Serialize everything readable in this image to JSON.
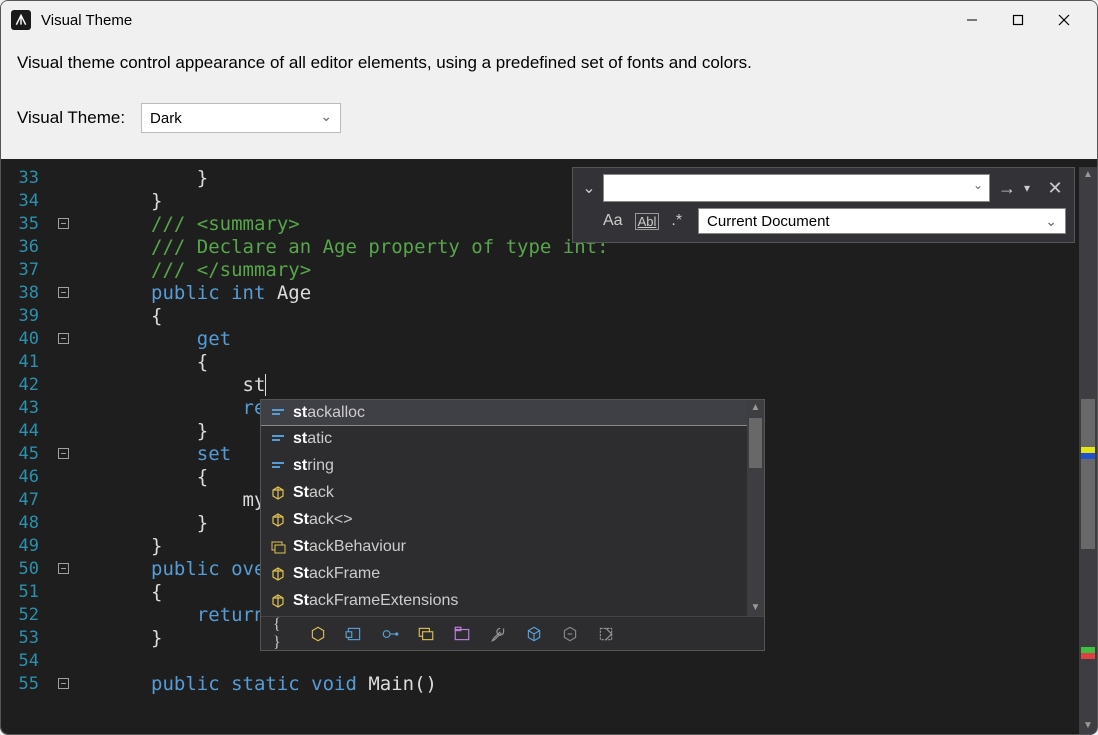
{
  "window": {
    "title": "Visual Theme"
  },
  "header": {
    "description": "Visual theme control appearance of all editor elements, using a predefined set of fonts and colors.",
    "label": "Visual Theme:",
    "selected": "Dark"
  },
  "find_panel": {
    "scope": "Current Document",
    "options": {
      "match_case": "Aa",
      "whole_word": "Abl",
      "regex": ".*"
    }
  },
  "code": {
    "lines": [
      {
        "n": 33,
        "fold": "",
        "mod": false,
        "ind": 3,
        "tokens": [
          {
            "t": "}",
            "c": "p"
          }
        ]
      },
      {
        "n": 34,
        "fold": "",
        "mod": false,
        "ind": 2,
        "tokens": [
          {
            "t": "}",
            "c": "p"
          }
        ]
      },
      {
        "n": 35,
        "fold": "box",
        "mod": false,
        "ind": 2,
        "tokens": [
          {
            "t": "/// <summary>",
            "c": "com"
          }
        ]
      },
      {
        "n": 36,
        "fold": "",
        "mod": false,
        "ind": 2,
        "tokens": [
          {
            "t": "/// Declare an Age property of type int:",
            "c": "com"
          }
        ]
      },
      {
        "n": 37,
        "fold": "",
        "mod": false,
        "ind": 2,
        "tokens": [
          {
            "t": "/// </summary>",
            "c": "com"
          }
        ]
      },
      {
        "n": 38,
        "fold": "box",
        "mod": false,
        "ind": 2,
        "tokens": [
          {
            "t": "public ",
            "c": "kw"
          },
          {
            "t": "int ",
            "c": "kw"
          },
          {
            "t": "Age",
            "c": "p"
          }
        ]
      },
      {
        "n": 39,
        "fold": "",
        "mod": false,
        "ind": 2,
        "tokens": [
          {
            "t": "{",
            "c": "p"
          }
        ]
      },
      {
        "n": 40,
        "fold": "box",
        "mod": false,
        "ind": 3,
        "tokens": [
          {
            "t": "get",
            "c": "kw"
          }
        ]
      },
      {
        "n": 41,
        "fold": "",
        "mod": true,
        "ind": 3,
        "tokens": [
          {
            "t": "{",
            "c": "p"
          }
        ]
      },
      {
        "n": 42,
        "fold": "",
        "mod": true,
        "ind": 4,
        "tokens": [
          {
            "t": "st",
            "c": "p"
          }
        ],
        "caret": true
      },
      {
        "n": 43,
        "fold": "",
        "mod": false,
        "ind": 4,
        "tokens": [
          {
            "t": "ret",
            "c": "kw"
          }
        ]
      },
      {
        "n": 44,
        "fold": "",
        "mod": false,
        "ind": 3,
        "tokens": [
          {
            "t": "}",
            "c": "p"
          }
        ]
      },
      {
        "n": 45,
        "fold": "box",
        "mod": false,
        "ind": 3,
        "tokens": [
          {
            "t": "set",
            "c": "kw"
          }
        ]
      },
      {
        "n": 46,
        "fold": "",
        "mod": false,
        "ind": 3,
        "tokens": [
          {
            "t": "{",
            "c": "p"
          }
        ]
      },
      {
        "n": 47,
        "fold": "",
        "mod": false,
        "ind": 4,
        "tokens": [
          {
            "t": "myA",
            "c": "p"
          }
        ]
      },
      {
        "n": 48,
        "fold": "",
        "mod": false,
        "ind": 3,
        "tokens": [
          {
            "t": "}",
            "c": "p"
          }
        ]
      },
      {
        "n": 49,
        "fold": "",
        "mod": false,
        "ind": 2,
        "tokens": [
          {
            "t": "}",
            "c": "p"
          }
        ]
      },
      {
        "n": 50,
        "fold": "box",
        "mod": false,
        "ind": 2,
        "tokens": [
          {
            "t": "public ",
            "c": "kw"
          },
          {
            "t": "over",
            "c": "kw"
          }
        ]
      },
      {
        "n": 51,
        "fold": "",
        "mod": false,
        "ind": 2,
        "tokens": [
          {
            "t": "{",
            "c": "p"
          }
        ]
      },
      {
        "n": 52,
        "fold": "",
        "mod": false,
        "ind": 3,
        "tokens": [
          {
            "t": "return",
            "c": "kw"
          }
        ]
      },
      {
        "n": 53,
        "fold": "",
        "mod": false,
        "ind": 2,
        "tokens": [
          {
            "t": "}",
            "c": "p"
          }
        ]
      },
      {
        "n": 54,
        "fold": "",
        "mod": false,
        "ind": 0,
        "tokens": []
      },
      {
        "n": 55,
        "fold": "box",
        "mod": false,
        "ind": 2,
        "tokens": [
          {
            "t": "public ",
            "c": "kw"
          },
          {
            "t": "static ",
            "c": "kw"
          },
          {
            "t": "void ",
            "c": "kw"
          },
          {
            "t": "Main()",
            "c": "p"
          }
        ]
      }
    ]
  },
  "intellisense": {
    "items": [
      {
        "icon": "keyword",
        "pre": "st",
        "rest": "ackalloc",
        "selected": true
      },
      {
        "icon": "keyword",
        "pre": "st",
        "rest": "atic"
      },
      {
        "icon": "keyword",
        "pre": "st",
        "rest": "ring"
      },
      {
        "icon": "class",
        "pre": "St",
        "rest": "ack"
      },
      {
        "icon": "class",
        "pre": "St",
        "rest": "ack<>"
      },
      {
        "icon": "enum",
        "pre": "St",
        "rest": "ackBehaviour"
      },
      {
        "icon": "class",
        "pre": "St",
        "rest": "ackFrame"
      },
      {
        "icon": "class",
        "pre": "St",
        "rest": "ackFrameExtensions"
      }
    ],
    "filters": [
      "braces",
      "class",
      "struct",
      "interface",
      "enum",
      "namespace",
      "wrench",
      "cube",
      "method",
      "snippet"
    ]
  }
}
